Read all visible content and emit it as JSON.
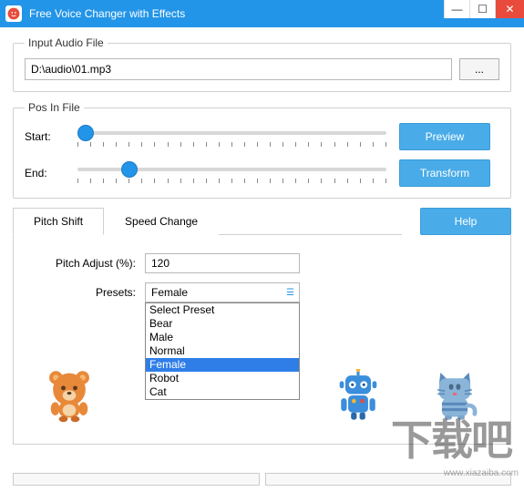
{
  "window": {
    "title": "Free Voice Changer with Effects"
  },
  "input_section": {
    "legend": "Input Audio File",
    "path": "D:\\audio\\01.mp3",
    "browse_label": "..."
  },
  "pos_section": {
    "legend": "Pos In File",
    "start_label": "Start:",
    "end_label": "End:",
    "start_value": 0,
    "end_value": 15,
    "preview_label": "Preview",
    "transform_label": "Transform"
  },
  "tabs": {
    "pitch": "Pitch Shift",
    "speed": "Speed Change",
    "help": "Help"
  },
  "pitch_panel": {
    "adjust_label": "Pitch Adjust (%):",
    "adjust_value": "120",
    "presets_label": "Presets:",
    "preset_selected": "Female",
    "preset_options": [
      "Select Preset",
      "Bear",
      "Male",
      "Normal",
      "Female",
      "Robot",
      "Cat"
    ]
  },
  "characters": {
    "bear": "bear-icon",
    "robot": "robot-icon",
    "cat": "cat-icon"
  },
  "watermark": {
    "url": "www.xiazaiba.com",
    "text": "下载吧"
  }
}
